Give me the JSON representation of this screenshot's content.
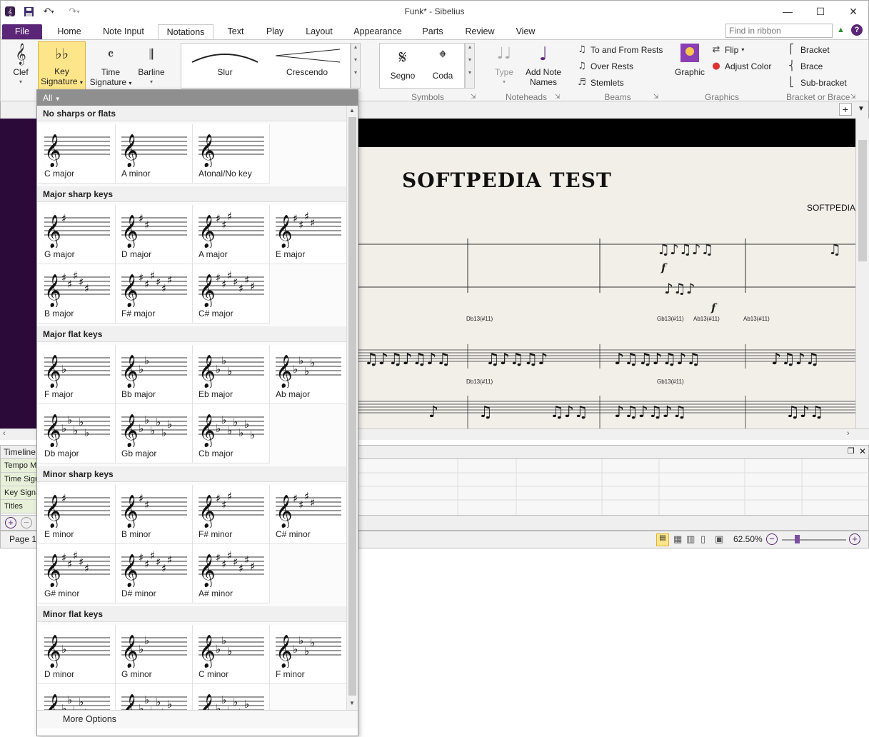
{
  "window": {
    "title": "Funk* - Sibelius",
    "undo_icon": "undo-icon",
    "redo_icon": "redo-icon"
  },
  "tabs": [
    "File",
    "Home",
    "Note Input",
    "Notations",
    "Text",
    "Play",
    "Layout",
    "Appearance",
    "Parts",
    "Review",
    "View"
  ],
  "active_tab": "Notations",
  "ribbon_search": {
    "placeholder": "Find in ribbon"
  },
  "ribbon": {
    "clef": "Clef",
    "key_signature": "Key Signature",
    "time_signature": "Time Signature",
    "barline": "Barline",
    "lines_gallery": [
      "Slur",
      "Crescendo"
    ],
    "symbols_gallery": [
      "Segno",
      "Coda"
    ],
    "symbols_label": "Symbols",
    "noteheads": {
      "type": "Type",
      "add_note_names": "Add Note Names",
      "label": "Noteheads"
    },
    "beams": {
      "to_from_rests": "To and From Rests",
      "over_rests": "Over Rests",
      "stemlets": "Stemlets",
      "label": "Beams"
    },
    "graphics": {
      "graphic": "Graphic",
      "flip": "Flip",
      "adjust_color": "Adjust Color",
      "label": "Graphics"
    },
    "brackets": {
      "bracket": "Bracket",
      "brace": "Brace",
      "sub_bracket": "Sub-bracket",
      "label": "Bracket or Brace"
    }
  },
  "score": {
    "title": "SOFTPEDIA  TEST",
    "composer": "SOFTPEDIA",
    "dynamics": [
      "f",
      "f"
    ],
    "chord_symbols_row1": [
      "Db13(#11)",
      "Gb13(#11)",
      "Ab13(#11)",
      "Ab13(#11)"
    ],
    "chord_symbols_row2": [
      "Db13(#11)",
      "Gb13(#11)"
    ]
  },
  "timeline": {
    "title": "Timeline",
    "rows": [
      "Tempo Marks",
      "Time Signatures",
      "Key Signatures",
      "Titles"
    ]
  },
  "status": {
    "page": "Page 1",
    "zoom": "62.50%"
  },
  "key_signature_popup": {
    "filter": "All",
    "more_options": "More Options",
    "sections": [
      {
        "title": "No sharps or flats",
        "items": [
          {
            "label": "C major",
            "kind": "none",
            "count": 0
          },
          {
            "label": "A minor",
            "kind": "none",
            "count": 0
          },
          {
            "label": "Atonal/No key",
            "kind": "none",
            "count": 0
          }
        ]
      },
      {
        "title": "Major sharp keys",
        "items": [
          {
            "label": "G major",
            "kind": "sharp",
            "count": 1
          },
          {
            "label": "D major",
            "kind": "sharp",
            "count": 2
          },
          {
            "label": "A major",
            "kind": "sharp",
            "count": 3
          },
          {
            "label": "E major",
            "kind": "sharp",
            "count": 4
          },
          {
            "label": "B major",
            "kind": "sharp",
            "count": 5
          },
          {
            "label": "F# major",
            "kind": "sharp",
            "count": 6
          },
          {
            "label": "C# major",
            "kind": "sharp",
            "count": 7
          }
        ]
      },
      {
        "title": "Major flat keys",
        "items": [
          {
            "label": "F major",
            "kind": "flat",
            "count": 1
          },
          {
            "label": "Bb major",
            "kind": "flat",
            "count": 2
          },
          {
            "label": "Eb major",
            "kind": "flat",
            "count": 3
          },
          {
            "label": "Ab major",
            "kind": "flat",
            "count": 4
          },
          {
            "label": "Db major",
            "kind": "flat",
            "count": 5
          },
          {
            "label": "Gb major",
            "kind": "flat",
            "count": 6
          },
          {
            "label": "Cb major",
            "kind": "flat",
            "count": 7
          }
        ]
      },
      {
        "title": "Minor sharp keys",
        "items": [
          {
            "label": "E minor",
            "kind": "sharp",
            "count": 1
          },
          {
            "label": "B minor",
            "kind": "sharp",
            "count": 2
          },
          {
            "label": "F# minor",
            "kind": "sharp",
            "count": 3
          },
          {
            "label": "C# minor",
            "kind": "sharp",
            "count": 4
          },
          {
            "label": "G# minor",
            "kind": "sharp",
            "count": 5
          },
          {
            "label": "D# minor",
            "kind": "sharp",
            "count": 6
          },
          {
            "label": "A# minor",
            "kind": "sharp",
            "count": 7
          }
        ]
      },
      {
        "title": "Minor flat keys",
        "items": [
          {
            "label": "D minor",
            "kind": "flat",
            "count": 1
          },
          {
            "label": "G minor",
            "kind": "flat",
            "count": 2
          },
          {
            "label": "C minor",
            "kind": "flat",
            "count": 3
          },
          {
            "label": "F minor",
            "kind": "flat",
            "count": 4
          },
          {
            "label": "",
            "kind": "flat",
            "count": 5
          },
          {
            "label": "",
            "kind": "flat",
            "count": 6
          },
          {
            "label": "",
            "kind": "flat",
            "count": 7
          }
        ]
      }
    ]
  },
  "colors": {
    "file_tab": "#5b2677",
    "selected": "#fde68a",
    "score_bg": "#2b0a3a",
    "paper": "#f2efe9"
  }
}
